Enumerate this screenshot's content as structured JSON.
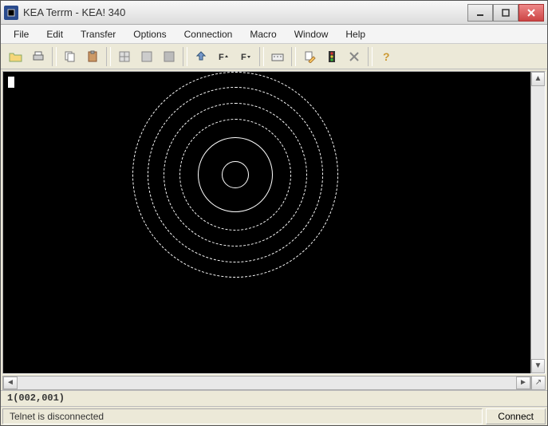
{
  "titlebar": {
    "text": "KEA Terrm - KEA! 340"
  },
  "menu": {
    "file": "File",
    "edit": "Edit",
    "transfer": "Transfer",
    "options": "Options",
    "connection": "Connection",
    "macro": "Macro",
    "window": "Window",
    "help": "Help"
  },
  "position": "1(002,001)",
  "status": {
    "text": "Telnet is disconnected",
    "connect": "Connect"
  },
  "toolbar_icons": [
    "open-icon",
    "print-icon",
    "copy-icon",
    "paste-icon",
    "sep",
    "grid1-icon",
    "grid2-icon",
    "grid3-icon",
    "sep",
    "align-icon",
    "font-up-icon",
    "font-down-icon",
    "sep",
    "keyboard-icon",
    "sep",
    "edit-icon",
    "traffic-icon",
    "clear-icon",
    "sep",
    "help-icon"
  ]
}
